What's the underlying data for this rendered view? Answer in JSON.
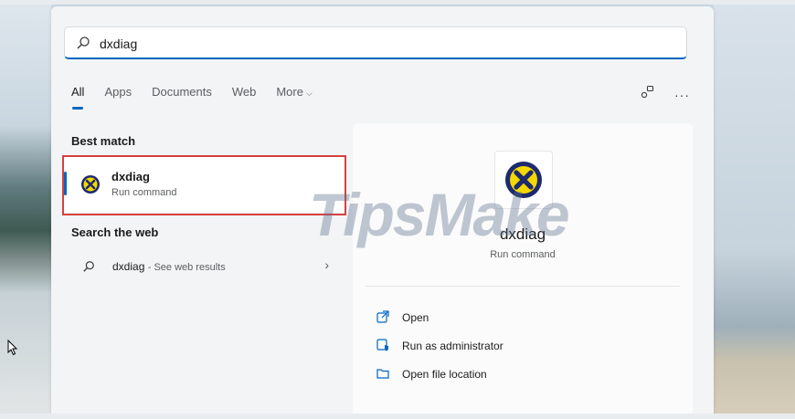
{
  "search": {
    "query": "dxdiag",
    "placeholder": ""
  },
  "tabs": [
    {
      "label": "All"
    },
    {
      "label": "Apps"
    },
    {
      "label": "Documents"
    },
    {
      "label": "Web"
    },
    {
      "label": "More"
    }
  ],
  "sections": {
    "best_match": "Best match",
    "search_web": "Search the web"
  },
  "best_match": {
    "name": "dxdiag",
    "type": "Run command"
  },
  "web_result": {
    "query": "dxdiag",
    "suffix": "- See web results"
  },
  "detail": {
    "name": "dxdiag",
    "type": "Run command",
    "actions": [
      {
        "label": "Open"
      },
      {
        "label": "Run as administrator"
      },
      {
        "label": "Open file location"
      }
    ]
  },
  "watermark": "TipsMake",
  "colors": {
    "accent": "#0067c0",
    "highlight": "#d64040",
    "icon_yellow": "#f5d800",
    "icon_navy": "#1c2a6e"
  }
}
